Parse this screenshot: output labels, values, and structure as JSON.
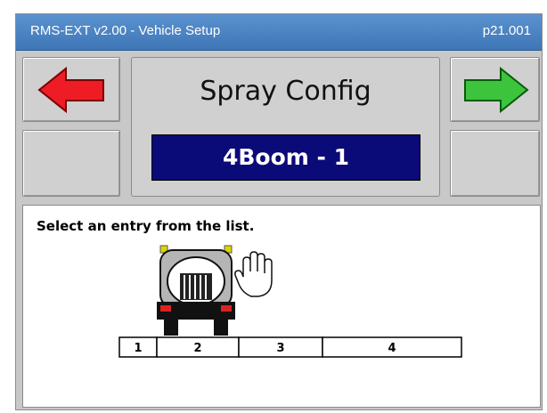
{
  "window": {
    "title": "RMS-EXT v2.00 - Vehicle Setup",
    "page_id": "p21.001"
  },
  "nav": {
    "prev_icon": "left-arrow-icon",
    "next_icon": "right-arrow-icon",
    "prev_color": "#ee1c24",
    "next_color": "#3cc43c"
  },
  "setting": {
    "title": "Spray Config",
    "value": "4Boom - 1",
    "value_bg": "#0a0a78"
  },
  "content": {
    "instruction": "Select an entry from the list.",
    "booms": [
      "1",
      "2",
      "3",
      "4"
    ],
    "vehicle_icon": "truck-rear-icon",
    "pointer_icon": "hand-pointer-icon"
  }
}
